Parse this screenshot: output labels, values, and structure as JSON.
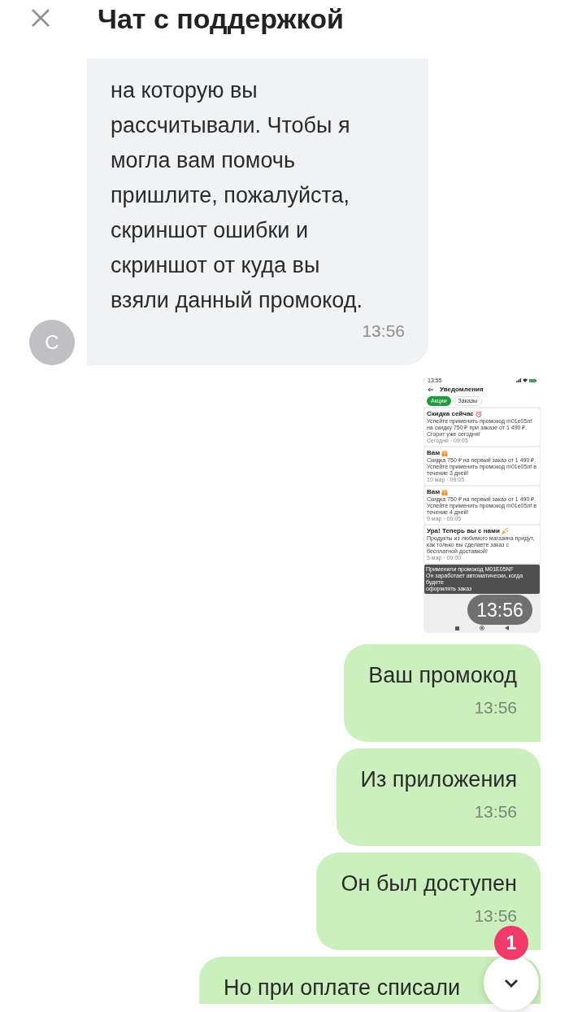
{
  "header": {
    "title": "Чат с поддержкой"
  },
  "messages": [
    {
      "kind": "text",
      "outgoing": false,
      "avatar": "С",
      "text": "на которую вы\nрассчитывали. Чтобы я\nмогла вам помочь\nпришлите, пожалуйста,\nскриншот ошибки и\nскриншот от куда вы\nвзяли данный промокод.",
      "time": "13:56"
    },
    {
      "kind": "image",
      "outgoing": true,
      "time": "13:56",
      "screenshot": {
        "status_bar": {
          "time": "13:55"
        },
        "title": "Уведомления",
        "tabs": [
          {
            "label": "Акции",
            "selected": true
          },
          {
            "label": "Заказы",
            "selected": false
          }
        ],
        "notifications": [
          {
            "kind": "alarm",
            "title": "Скидка сейчас",
            "text": "Успейте применить промокод m01e05nf на скидку 750 ₽ при заказе от 1 490 ₽. Сгорит уже сегодня!",
            "date": "Сегодня · 09:05"
          },
          {
            "kind": "gift",
            "title": "Вам",
            "text": "Скидка 750 ₽ на первый заказ от 1 490 ₽. Успейте применить промокод m01e05nf в течение 3 дней!",
            "date": "10 мар · 09:05"
          },
          {
            "kind": "gift",
            "title": "Вам",
            "text": "Скидка 750 ₽ на первый заказ от 1 490 ₽. Успейте применить промокод m01e05nf в течение 4 дней!",
            "date": "9 мар · 09:05"
          },
          {
            "kind": "party",
            "title": "Ура! Теперь вы с нами",
            "text": "Продукты из любимого магазина придут, как только вы сделаете заказ с бесплатной доставкой!",
            "date": "5 мар · 09:00"
          }
        ],
        "toast": "Применили промокод M01E05NF\nОн заработает автоматически, когда будете\nоформлять заказ"
      }
    },
    {
      "kind": "text",
      "outgoing": true,
      "text": "Ваш промокод",
      "time": "13:56"
    },
    {
      "kind": "text",
      "outgoing": true,
      "text": "Из приложения",
      "time": "13:56"
    },
    {
      "kind": "text",
      "outgoing": true,
      "text": "Он был доступен",
      "time": "13:56"
    },
    {
      "kind": "text",
      "outgoing": true,
      "text": "Но при оплате списали"
    }
  ],
  "scroll_button": {
    "badge": "1"
  }
}
